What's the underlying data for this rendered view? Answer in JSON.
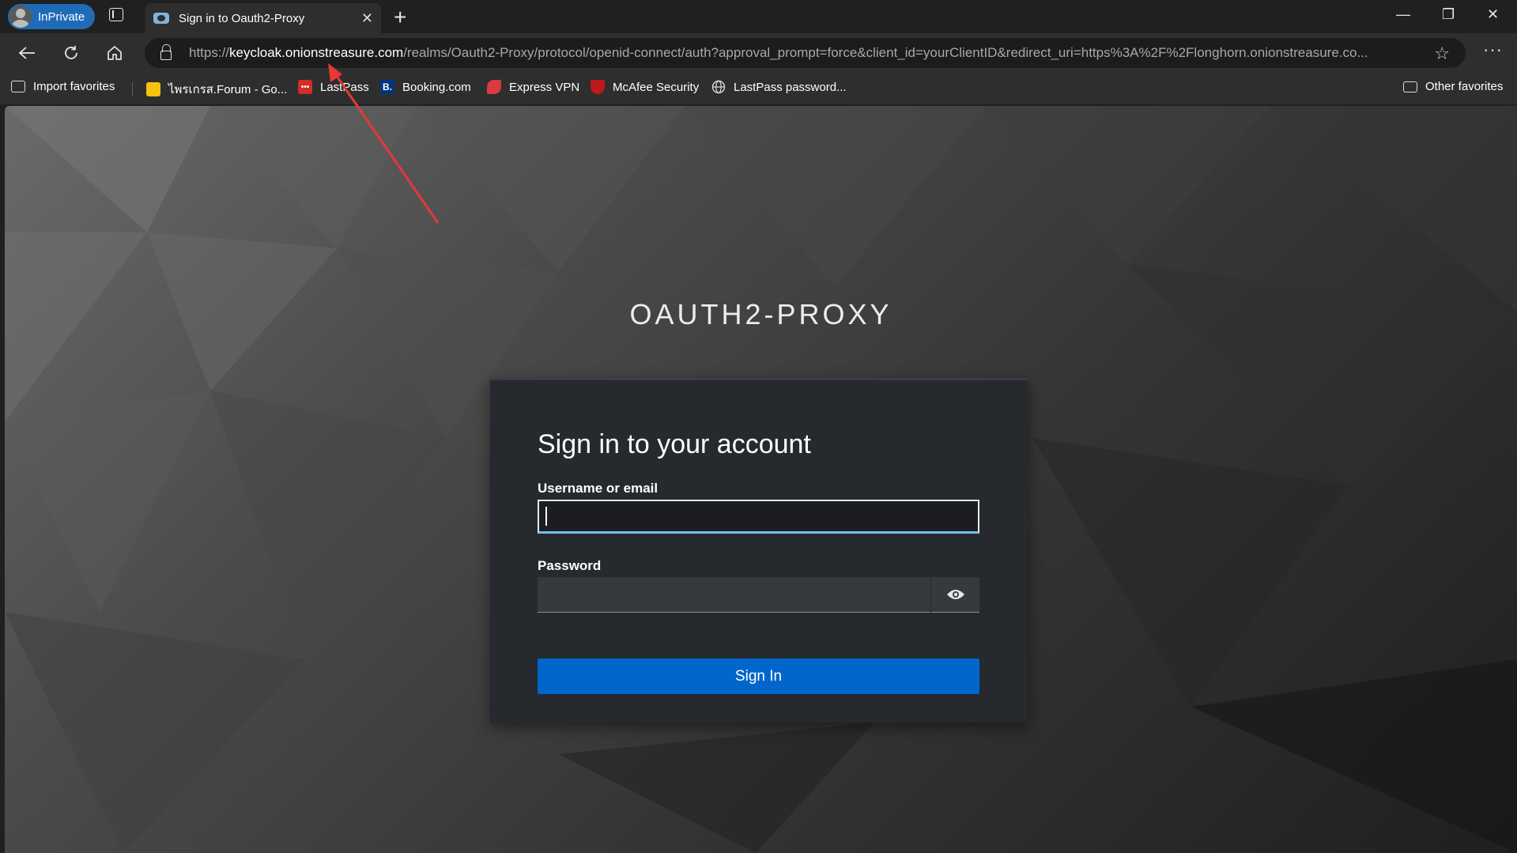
{
  "browser": {
    "profile_label": "InPrivate",
    "tab_title": "Sign in to Oauth2-Proxy",
    "tab_close": "✕",
    "new_tab": "+",
    "window": {
      "minimize": "—",
      "restore": "❐",
      "close": "✕"
    }
  },
  "address_bar": {
    "scheme": "https://",
    "host": "keycloak.onionstreasure.com",
    "path": "/realms/Oauth2-Proxy/protocol/openid-connect/auth?approval_prompt=force&client_id=yourClientID&redirect_uri=https%3A%2F%2Flonghorn.onionstreasure.co..."
  },
  "favorites": {
    "items": [
      {
        "label": "Import favorites",
        "icon": "import-icon"
      },
      {
        "label": "ไพรเกรส.Forum - Go...",
        "icon": "folder-yellow-icon"
      },
      {
        "label": "LastPass",
        "icon": "lastpass-icon"
      },
      {
        "label": "Booking.com",
        "icon": "booking-icon"
      },
      {
        "label": "Express VPN",
        "icon": "expressvpn-icon"
      },
      {
        "label": "McAfee Security",
        "icon": "mcafee-icon"
      },
      {
        "label": "LastPass password...",
        "icon": "globe-icon"
      }
    ],
    "other": "Other favorites"
  },
  "page": {
    "realm_title": "OAUTH2-PROXY",
    "heading": "Sign in to your account",
    "username_label": "Username or email",
    "username_value": "",
    "password_label": "Password",
    "password_value": "",
    "submit_label": "Sign In"
  },
  "colors": {
    "primary_button": "#0066cc",
    "focus_underline": "#73bcf7",
    "annotation_arrow": "#e53935"
  }
}
